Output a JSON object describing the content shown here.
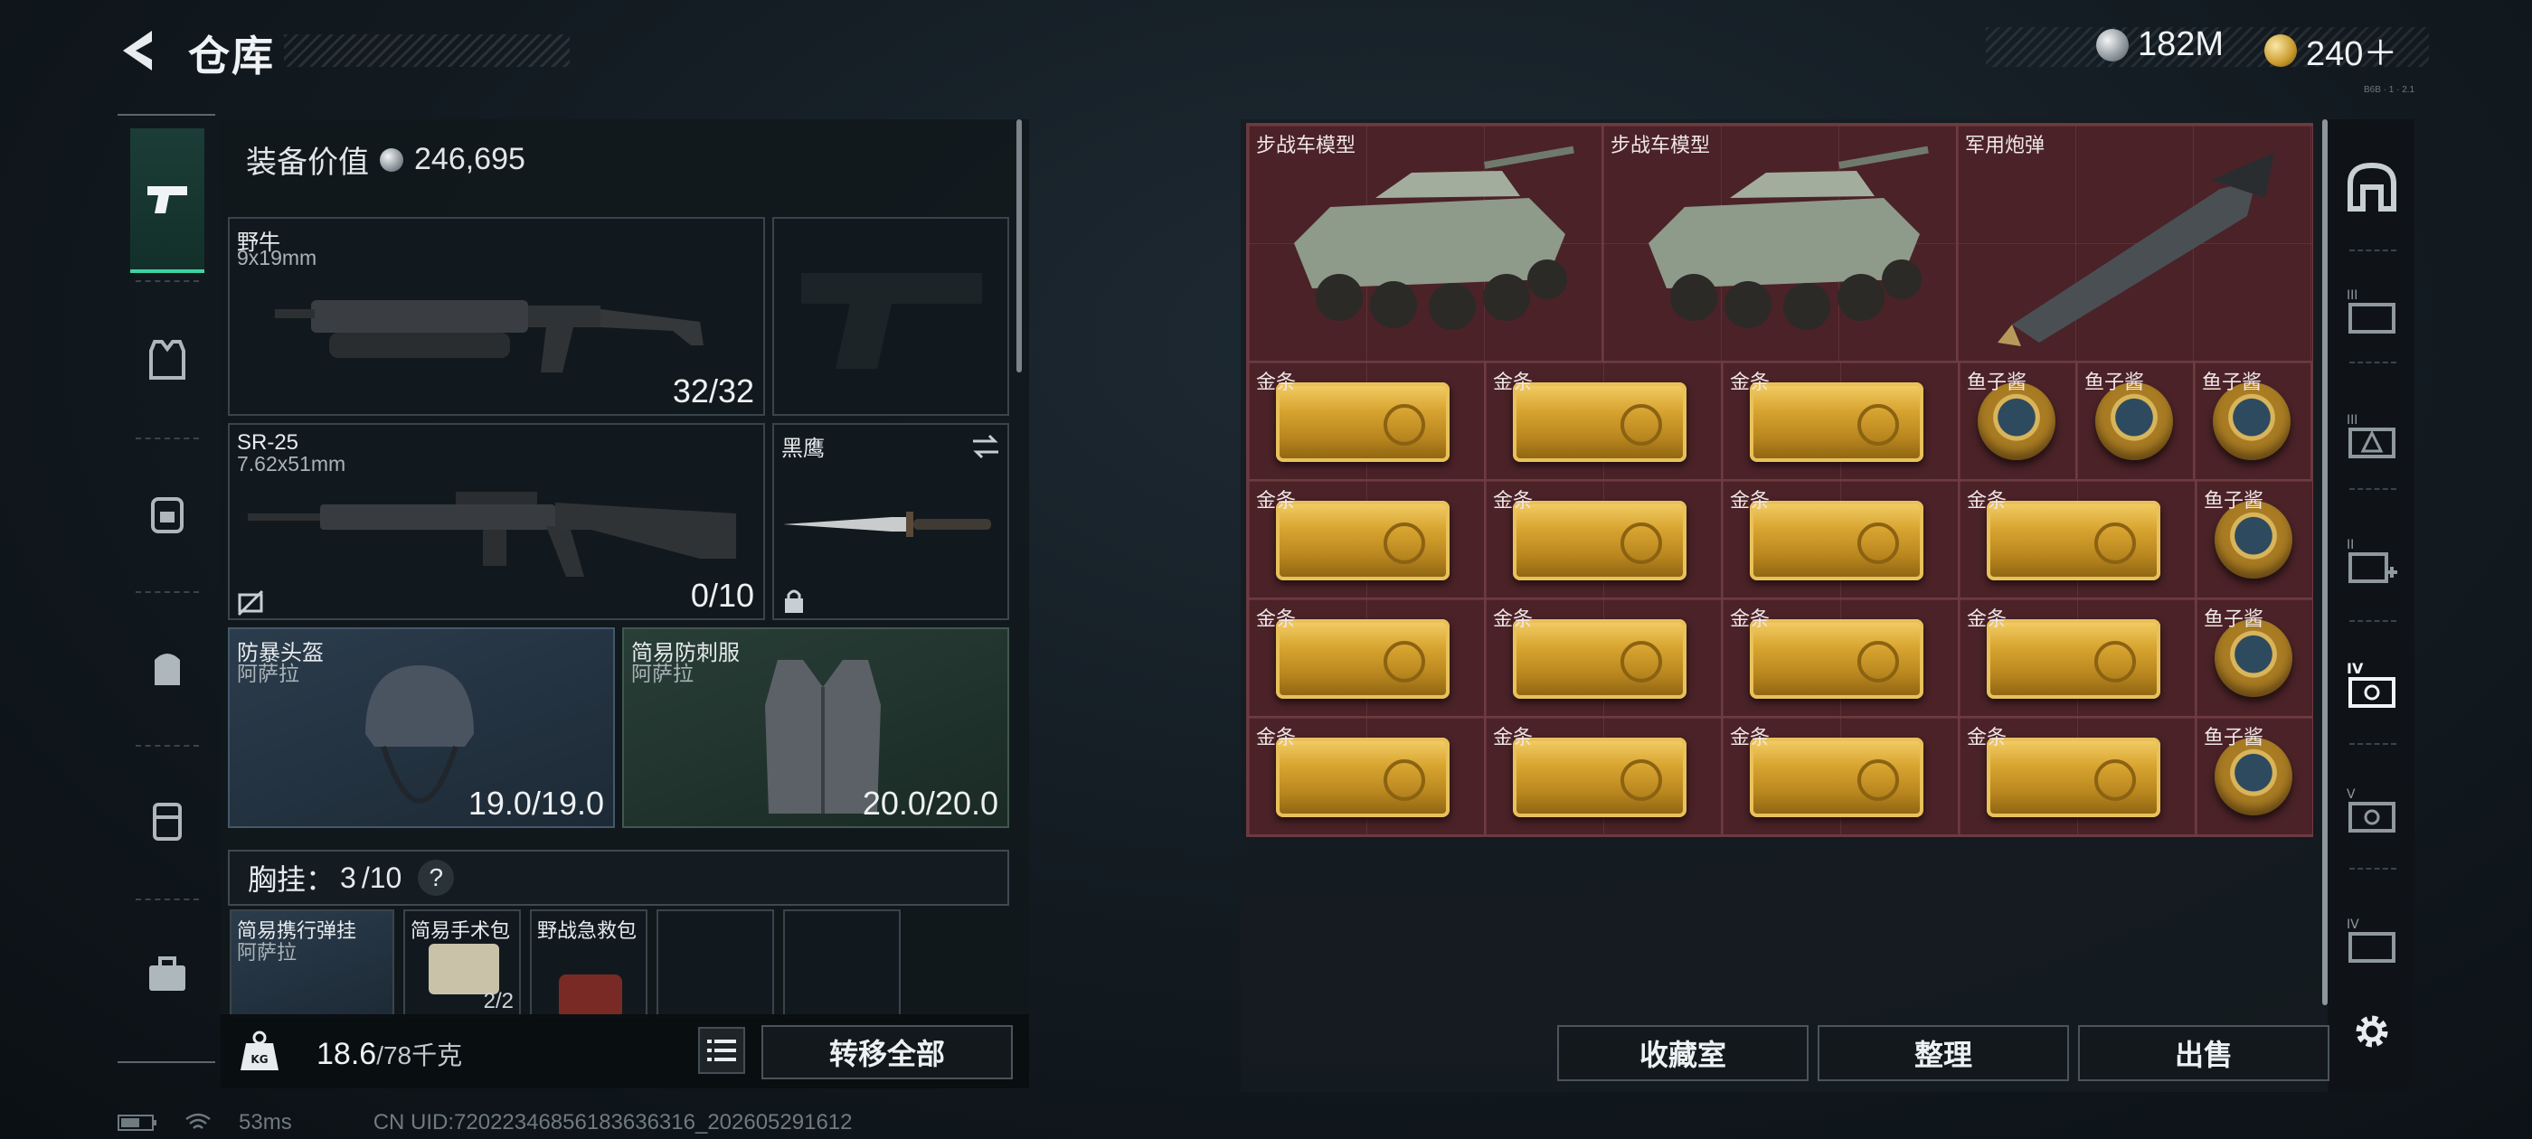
{
  "header": {
    "title": "仓库"
  },
  "currency": {
    "silver": "182M",
    "gold": "240＋"
  },
  "corner_note": "B6B · 1 · 2.1",
  "equipment": {
    "value_label": "装备价值",
    "value": "246,695",
    "primary_weapon": {
      "name": "野牛",
      "caliber": "9x19mm",
      "ammo": "32/32"
    },
    "secondary_weapon": {
      "name": "SR-25",
      "caliber": "7.62x51mm",
      "ammo": "0/10"
    },
    "melee": {
      "name": "黑鹰"
    },
    "helmet": {
      "name": "防暴头盔",
      "brand": "阿萨拉",
      "durability": "19.0/19.0"
    },
    "armor": {
      "name": "简易防刺服",
      "brand": "阿萨拉",
      "durability": "20.0/20.0"
    },
    "chest_rig": {
      "label": "胸挂：",
      "used": "3",
      "capacity": "/10",
      "help": "?"
    },
    "rig_items": [
      {
        "name": "简易携行弹挂",
        "brand": "阿萨拉"
      },
      {
        "name": "简易手术包",
        "count": "2/2"
      },
      {
        "name": "野战急救包"
      }
    ],
    "weight": {
      "current": "18.6",
      "max": "/78千克"
    },
    "transfer_all": "转移全部"
  },
  "storage": {
    "large_items": [
      {
        "label": "步战车模型"
      },
      {
        "label": "步战车模型"
      },
      {
        "label": "军用炮弹"
      }
    ],
    "gold_label": "金条",
    "caviar_label": "鱼子酱",
    "rows": [
      [
        "金条",
        "金条",
        "金条",
        "鱼子酱",
        "鱼子酱",
        "鱼子酱"
      ],
      [
        "金条",
        "金条",
        "金条",
        "金条",
        "鱼子酱"
      ],
      [
        "金条",
        "金条",
        "金条",
        "金条",
        "鱼子酱"
      ],
      [
        "金条",
        "金条",
        "金条",
        "金条",
        "鱼子酱"
      ]
    ]
  },
  "actions": {
    "collection": "收藏室",
    "organize": "整理",
    "sell": "出售"
  },
  "status": {
    "ping": "53ms",
    "uid": "CN UID:72022346856183636316_202605291612"
  },
  "colors": {
    "accent_green": "#3ed3a1",
    "storage_bg": "#4a2227",
    "gold": "#d8a531"
  }
}
